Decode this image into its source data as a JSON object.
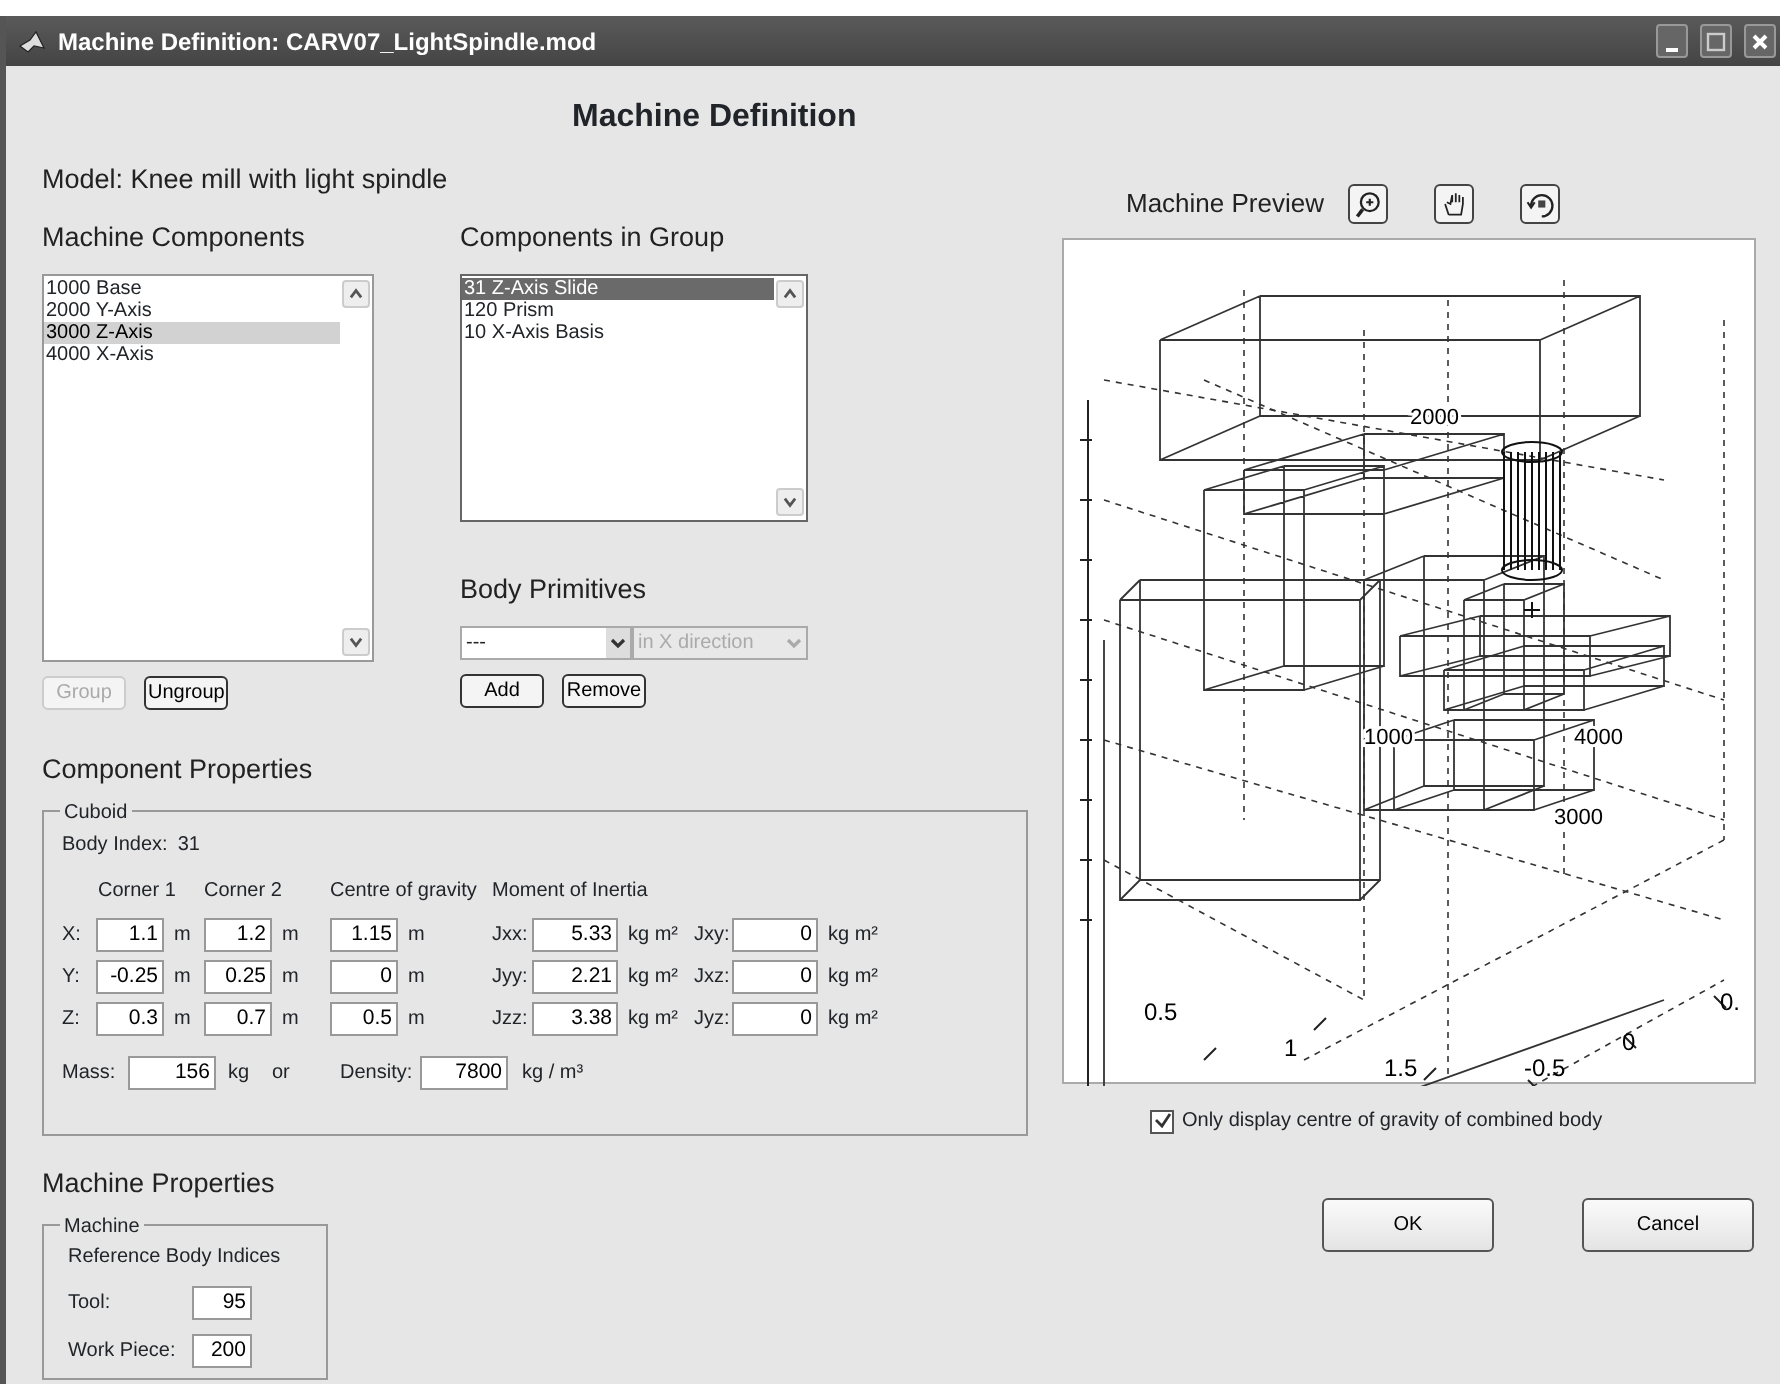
{
  "window": {
    "title": "Machine Definition: CARV07_LightSpindle.mod"
  },
  "heading": "Machine Definition",
  "model": "Model: Knee mill with light spindle",
  "machine_components": {
    "label": "Machine Components",
    "focused": false,
    "items": [
      {
        "text": "1000 Base",
        "selected": false
      },
      {
        "text": "2000 Y-Axis",
        "selected": false
      },
      {
        "text": "3000 Z-Axis",
        "selected": true
      },
      {
        "text": "4000 X-Axis",
        "selected": false
      }
    ]
  },
  "group_buttons": [
    {
      "label": "Group",
      "disabled": true
    },
    {
      "label": "Ungroup",
      "disabled": false
    }
  ],
  "components_in_group": {
    "label": "Components in Group",
    "focused": true,
    "items": [
      {
        "text": "31 Z-Axis Slide",
        "selected": true
      },
      {
        "text": "120 Prism",
        "selected": false
      },
      {
        "text": "10 X-Axis Basis",
        "selected": false
      }
    ]
  },
  "body_primitives": {
    "label": "Body Primitives",
    "shape": {
      "value": "---",
      "disabled": false
    },
    "direction": {
      "value": "in X direction",
      "disabled": true
    },
    "buttons": [
      {
        "label": "Add"
      },
      {
        "label": "Remove"
      }
    ]
  },
  "component_properties": {
    "title": "Component Properties",
    "group": "Cuboid",
    "body_index_label": "Body Index:",
    "body_index": "31",
    "headers": [
      "Corner 1",
      "Corner 2",
      "Centre of gravity",
      "Moment of Inertia"
    ],
    "rows": [
      {
        "axis": "X:",
        "corner1": "1.1",
        "corner1_unit": "m",
        "corner2": "1.2",
        "corner2_unit": "m",
        "cog": "1.15",
        "cog_unit": "m",
        "j_label": "Jxx:",
        "j": "5.33",
        "j_unit": "kg m²",
        "jc_label": "Jxy:",
        "jc": "0",
        "jc_unit": "kg m²"
      },
      {
        "axis": "Y:",
        "corner1": "-0.25",
        "corner1_unit": "m",
        "corner2": "0.25",
        "corner2_unit": "m",
        "cog": "0",
        "cog_unit": "m",
        "j_label": "Jyy:",
        "j": "2.21",
        "j_unit": "kg m²",
        "jc_label": "Jxz:",
        "jc": "0",
        "jc_unit": "kg m²"
      },
      {
        "axis": "Z:",
        "corner1": "0.3",
        "corner1_unit": "m",
        "corner2": "0.7",
        "corner2_unit": "m",
        "cog": "0.5",
        "cog_unit": "m",
        "j_label": "Jzz:",
        "j": "3.38",
        "j_unit": "kg m²",
        "jc_label": "Jyz:",
        "jc": "0",
        "jc_unit": "kg m²"
      }
    ],
    "mass": {
      "label": "Mass:",
      "value": "156",
      "unit": "kg"
    },
    "or": "or",
    "density": {
      "label": "Density:",
      "value": "7800",
      "unit": "kg / m³"
    }
  },
  "machine_properties": {
    "title": "Machine Properties",
    "group": "Machine",
    "subtitle": "Reference Body Indices",
    "fields": [
      {
        "label": "Tool:",
        "value": "95"
      },
      {
        "label": "Work Piece:",
        "value": "200"
      }
    ]
  },
  "preview": {
    "label": "Machine Preview",
    "tools": [
      {
        "kind": "zoom"
      },
      {
        "kind": "pan"
      },
      {
        "kind": "rotate"
      }
    ],
    "tick_labels": [
      "0.5",
      "1",
      "1.5",
      "-0.5",
      "0",
      "0."
    ],
    "component_labels": [
      "2000",
      "1000",
      "4000",
      "3000"
    ]
  },
  "checkbox": {
    "label": "Only display centre of gravity of combined body",
    "checked": true
  },
  "buttons": [
    {
      "label": "OK"
    },
    {
      "label": "Cancel"
    }
  ]
}
